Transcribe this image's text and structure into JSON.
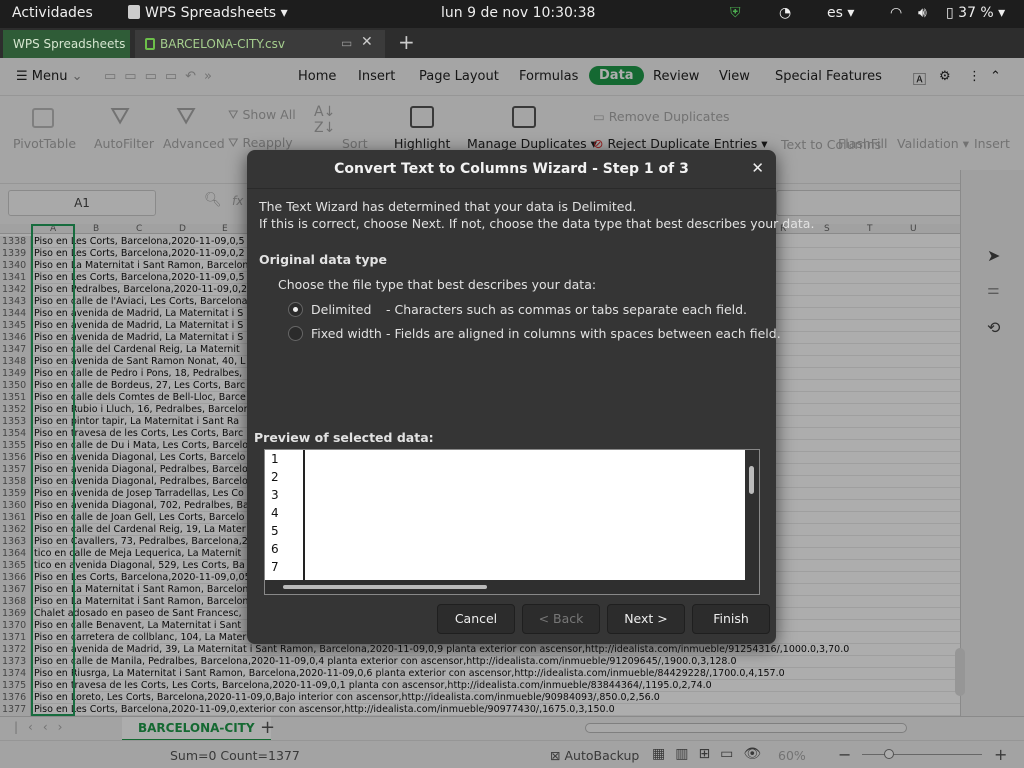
{
  "topbar": {
    "activities": "Actividades",
    "app_menu": "WPS Spreadsheets",
    "clock": "lun  9 de nov  10:30:38",
    "language": "es",
    "battery": "37 %"
  },
  "tabs": {
    "home": "WPS Spreadsheets",
    "file": "BARCELONA-CITY.csv"
  },
  "menu": {
    "menu_label": "Menu",
    "items": [
      "Home",
      "Insert",
      "Page Layout",
      "Formulas",
      "Data",
      "Review",
      "View",
      "Special Features"
    ],
    "active": "Data"
  },
  "ribbon": {
    "pivot": "PivotTable",
    "autofilter": "AutoFilter",
    "advanced": "Advanced",
    "show_all": "Show All",
    "reapply": "Reapply",
    "sort": "Sort",
    "highlight": "Highlight",
    "manage_duplicates": "Manage Duplicates",
    "remove_duplicates": "Remove Duplicates",
    "reject_duplicates": "Reject Duplicate Entries",
    "text_to_columns": "Text to Columns",
    "flashfill": "FlashFill",
    "validation": "Validation",
    "insert": "Insert"
  },
  "formula": {
    "namebox": "A1",
    "fx": "fx"
  },
  "sheet": {
    "columns": [
      "A",
      "B",
      "C",
      "D",
      "E",
      "R",
      "S",
      "T",
      "U"
    ],
    "rows": [
      {
        "n": "1338",
        "text": "Piso en Les Corts, Barcelona,2020-11-09,0,5",
        "right": ""
      },
      {
        "n": "1339",
        "text": "Piso en Les Corts, Barcelona,2020-11-09,0,2",
        "right": ""
      },
      {
        "n": "1340",
        "text": "Piso en La Maternitat i Sant Ramon, Barcelon",
        "right": ""
      },
      {
        "n": "1341",
        "text": "Piso en Les Corts, Barcelona,2020-11-09,0,5",
        "right": ""
      },
      {
        "n": "1342",
        "text": "Piso en Pedralbes, Barcelona,2020-11-09,0,2",
        "right": ""
      },
      {
        "n": "1343",
        "text": "Piso en calle de l'Aviaci, Les Corts, Barcelona",
        "right": ""
      },
      {
        "n": "1344",
        "text": "Piso en avenida de Madrid, La Maternitat i S",
        "right": "6/,1090.0,2,73.0"
      },
      {
        "n": "1345",
        "text": "Piso en avenida de Madrid, La Maternitat i S",
        "right": "6/,1150.0,3,79.0"
      },
      {
        "n": "1346",
        "text": "Piso en avenida de Madrid, La Maternitat i S",
        "right": "9/,1090.0,2,73.0"
      },
      {
        "n": "1347",
        "text": "Piso en calle del Cardenal Reig, La Maternit",
        "right": "9/,1550.0,4,130.0"
      },
      {
        "n": "1348",
        "text": "Piso en avenida de Sant Ramon Nonat, 40, L",
        "right": "e/90397781/,880.0,1,45.0"
      },
      {
        "n": "1349",
        "text": "Piso en calle de Pedro i Pons, 18, Pedralbes,",
        "right": "0"
      },
      {
        "n": "1350",
        "text": "Piso en calle de Bordeus, 27, Les Corts, Barc",
        "right": ""
      },
      {
        "n": "1351",
        "text": "Piso en calle dels Comtes de Bell-Lloc, Barce",
        "right": "29727/,1185.0,3,90.0"
      },
      {
        "n": "1352",
        "text": "Piso en Rubio i Lluch, 16, Pedralbes, Barcelon",
        "right": ""
      },
      {
        "n": "1353",
        "text": "Piso en pintor tapir, La Maternitat i Sant Ra",
        "right": ""
      },
      {
        "n": "1354",
        "text": "Piso en travesa de les Corts, Les Corts, Barc",
        "right": ""
      },
      {
        "n": "1355",
        "text": "Piso en calle de Du i Mata, Les Corts, Barcelo",
        "right": ""
      },
      {
        "n": "1356",
        "text": "Piso en avenida Diagonal, Les Corts, Barcelo",
        "right": ""
      },
      {
        "n": "1357",
        "text": "Piso en avenida Diagonal, Pedralbes, Barcelo",
        "right": ""
      },
      {
        "n": "1358",
        "text": "Piso en avenida Diagonal, Pedralbes, Barcelo",
        "right": ""
      },
      {
        "n": "1359",
        "text": "Piso en avenida de Josep Tarradellas, Les Co",
        "right": ""
      },
      {
        "n": "1360",
        "text": "Piso en avenida Diagonal, 702, Pedralbes, Ba",
        "right": ""
      },
      {
        "n": "1361",
        "text": "Piso en calle de Joan Gell, Les Corts, Barcelo",
        "right": ""
      },
      {
        "n": "1362",
        "text": "Piso en calle del Cardenal Reig, 19, La Mater",
        "right": "51244/,1550.0,4,140.0"
      },
      {
        "n": "1363",
        "text": "Piso en Cavallers, 73, Pedralbes, Barcelona,2",
        "right": ""
      },
      {
        "n": "1364",
        "text": "tico en calle de Meja Lequerica, La Maternit",
        "right": "41/,1250.0,3,90.0"
      },
      {
        "n": "1365",
        "text": "tico en avenida Diagonal, 529, Les Corts, Ba",
        "right": ""
      },
      {
        "n": "1366",
        "text": "Piso en Les Corts, Barcelona,2020-11-09,0,05",
        "right": ""
      },
      {
        "n": "1367",
        "text": "Piso en La Maternitat i Sant Ramon, Barcelon",
        "right": ""
      },
      {
        "n": "1368",
        "text": "Piso en La Maternitat i Sant Ramon, Barcelon",
        "right": ""
      },
      {
        "n": "1369",
        "text": "Chalet adosado en paseo de Sant Francesc,",
        "right": ""
      },
      {
        "n": "1370",
        "text": "Piso en calle Benavent, La Maternitat i Sant",
        "right": "0,2,90.0"
      },
      {
        "n": "1371",
        "text": "Piso en carretera de collblanc, 104, La Mater",
        "right": "63032/,1100.0,4,80.0"
      },
      {
        "n": "1372",
        "text": "Piso en avenida de Madrid, 39, La Maternitat i Sant Ramon, Barcelona,2020-11-09,0,9 planta exterior con ascensor,http://idealista.com/inmueble/91254316/,1000.0,3,70.0",
        "right": ""
      },
      {
        "n": "1373",
        "text": "Piso en calle de Manila, Pedralbes, Barcelona,2020-11-09,0,4 planta exterior con ascensor,http://idealista.com/inmueble/91209645/,1900.0,3,128.0",
        "right": ""
      },
      {
        "n": "1374",
        "text": "Piso en Riusrga, La Maternitat i Sant Ramon, Barcelona,2020-11-09,0,6 planta exterior con ascensor,http://idealista.com/inmueble/84429228/,1700.0,4,157.0",
        "right": ""
      },
      {
        "n": "1375",
        "text": "Piso en travesa de les Corts, Les Corts, Barcelona,2020-11-09,0,1 planta  con ascensor,http://idealista.com/inmueble/83844364/,1195.0,2,74.0",
        "right": ""
      },
      {
        "n": "1376",
        "text": "Piso en Loreto, Les Corts, Barcelona,2020-11-09,0,Bajo interior con ascensor,http://idealista.com/inmueble/90984093/,850.0,2,56.0",
        "right": ""
      },
      {
        "n": "1377",
        "text": "Piso en Les Corts, Barcelona,2020-11-09,0,exterior con ascensor,http://idealista.com/inmueble/90977430/,1675.0,3,150.0",
        "right": ""
      }
    ],
    "sheet_tab": "BARCELONA-CITY"
  },
  "status": {
    "sum_count": "Sum=0  Count=1377",
    "autobackup": "AutoBackup",
    "zoom": "60%"
  },
  "dialog": {
    "title": "Convert Text to Columns Wizard - Step 1 of 3",
    "intro_line1": "The Text Wizard has determined that your data is Delimited.",
    "intro_line2": "If this is correct, choose Next. If not, choose the data type that best describes your data.",
    "section_title": "Original data type",
    "choose_label": "Choose the file type that best describes your data:",
    "delimited_label": "Delimited",
    "delimited_desc": "- Characters such as commas or tabs separate each field.",
    "fixed_label": "Fixed width",
    "fixed_desc": "- Fields are aligned in columns with spaces between each field.",
    "preview_label": "Preview of selected data:",
    "preview_lines": [
      "1",
      "2",
      "3",
      "4",
      "5",
      "6",
      "7"
    ],
    "cancel": "Cancel",
    "back": "< Back",
    "next": "Next >",
    "finish": "Finish"
  }
}
